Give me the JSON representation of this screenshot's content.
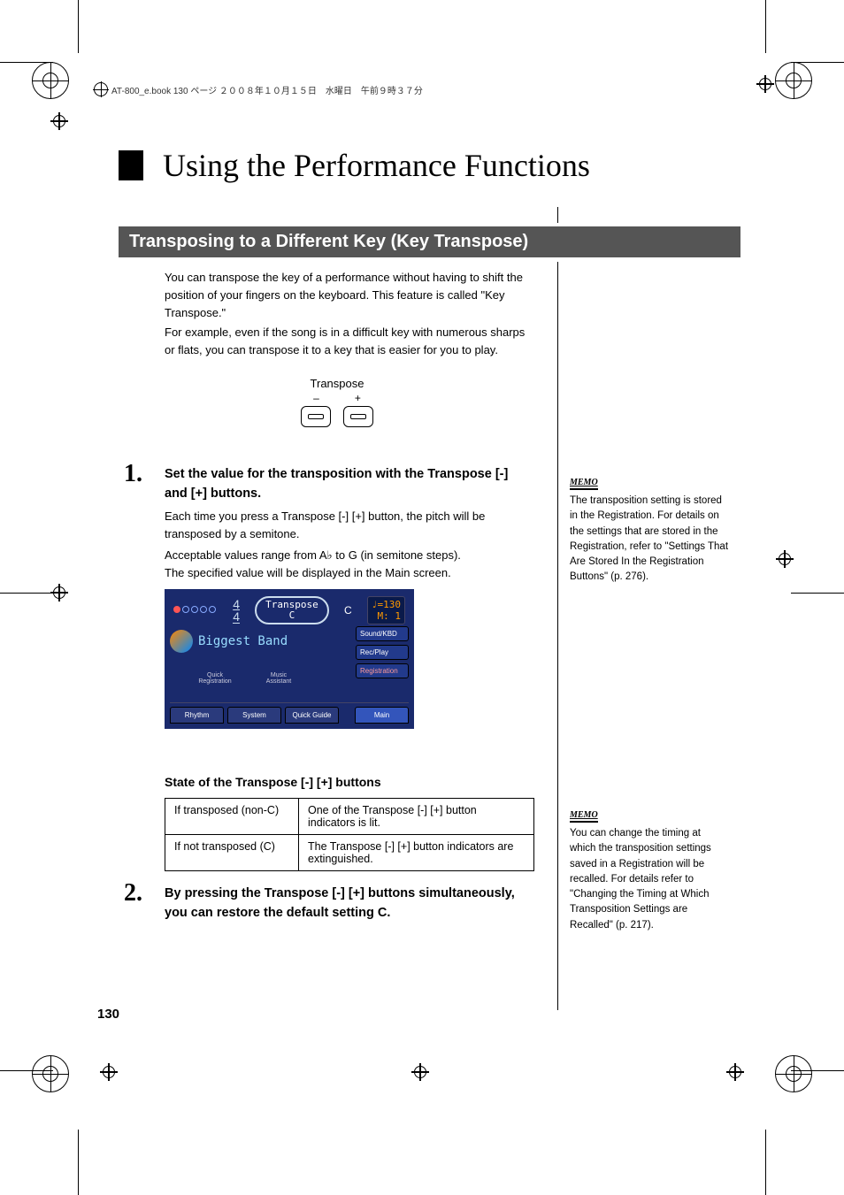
{
  "header": {
    "breadcrumb": "AT-800_e.book  130 ページ  ２００８年１０月１５日　水曜日　午前９時３７分"
  },
  "title": "Using the Performance Functions",
  "section_heading": "Transposing to a Different Key (Key Transpose)",
  "intro": {
    "p1": "You can transpose the key of a performance without having to shift the position of your fingers on the keyboard. This feature is called \"Key Transpose.\"",
    "p2": "For example, even if the song is in a difficult key with numerous sharps or flats, you can transpose it to a key that is easier for you to play."
  },
  "transpose_widget": {
    "label": "Transpose",
    "minus": "–",
    "plus": "+"
  },
  "steps": {
    "s1": {
      "num": "1.",
      "title": "Set the value for the transposition with the Transpose [-] and [+] buttons.",
      "body1": "Each time you press a Transpose [-] [+] button, the pitch will be transposed by a semitone.",
      "body2": "Acceptable values range from A♭ to G (in semitone steps).",
      "body3": "The specified value will be displayed in the Main screen."
    },
    "s2": {
      "num": "2.",
      "title": "By pressing the Transpose [-] [+] buttons simultaneously, you can restore the default setting C."
    }
  },
  "screen": {
    "timesig_top": "4",
    "timesig_bot": "4",
    "trans_label": "Transpose",
    "trans_value": "C",
    "key_c": "C",
    "tempo_line1": "♩=130",
    "tempo_line2": "M:   1",
    "group_big": "Biggest Band",
    "side": {
      "sound": "Sound/KBD",
      "rec": "Rec/Play",
      "reg": "Registration"
    },
    "quick_reg": "Quick Registration",
    "music_assist": "Music Assistant",
    "tabs": {
      "rhythm": "Rhythm",
      "system": "System",
      "quick": "Quick Guide",
      "main": "Main"
    }
  },
  "state_subhead": "State of the Transpose [-] [+] buttons",
  "state_table": {
    "r1c1": "If transposed (non-C)",
    "r1c2": "One of the Transpose [-] [+] button indicators is lit.",
    "r2c1": "If not transposed (C)",
    "r2c2": "The Transpose [-] [+] button indicators are extinguished."
  },
  "memo": {
    "label": "MEMO",
    "m1": "The transposition setting is stored in the Registration. For details on the settings that are stored in the Registration, refer to \"Settings That Are Stored In the Registration Buttons\" (p. 276).",
    "m2": "You can change the timing at which the transposition settings saved in a Registration will be recalled. For details refer to \"Changing the Timing at Which Transposition Settings are Recalled\" (p. 217)."
  },
  "page_number": "130"
}
